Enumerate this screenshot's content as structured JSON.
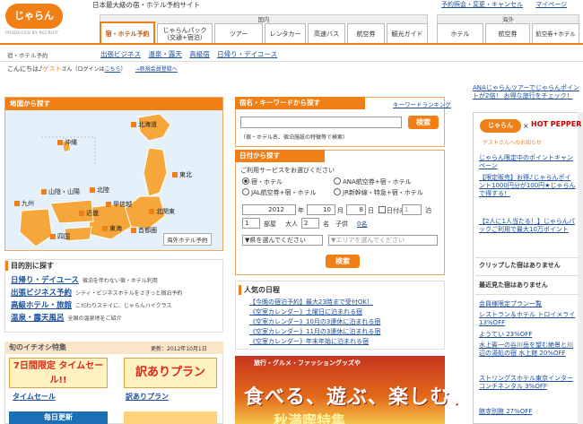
{
  "header": {
    "logo": "じゃらん",
    "logo_sub": "PRODUCED BY RECRUIT",
    "tagline": "日本最大級の宿・ホテル予約サイト",
    "links": [
      "予約照会・変更・キャンセル",
      "マイページ"
    ]
  },
  "tabs": {
    "domestic_label": "国内",
    "overseas_label": "海外",
    "domestic": [
      "宿・ホテル予約",
      "じゃらんパック（交通+宿泊）",
      "ツアー",
      "レンタカー",
      "高速バス",
      "航空券",
      "観光ガイド"
    ],
    "overseas": [
      "ホテル",
      "航空券",
      "航空券+ホテル"
    ]
  },
  "subnav": {
    "label": "宿・ホテル予約",
    "links": [
      "出張ビジネス",
      "温泉・露天",
      "高級宿",
      "日帰り・デイユース"
    ]
  },
  "greeting": {
    "prefix": "こんにちは♪",
    "name": "ゲスト",
    "suffix": "さん（ログインは",
    "login": "こちら",
    "close": "）",
    "register": "→新規会員登録へ"
  },
  "map": {
    "title": "地図から探す",
    "regions": [
      "北海道",
      "東北",
      "北関東",
      "首都圏",
      "甲信越",
      "北陸",
      "東海",
      "近畿",
      "山陰・山陽",
      "四国",
      "九州",
      "沖縄"
    ],
    "overseas": "海外ホテル予約"
  },
  "purpose": {
    "title": "目的別に探す",
    "rows": [
      {
        "link": "日帰り・デイユース",
        "desc": "宿泊を伴わない宿・ホテル利用"
      },
      {
        "link": "出張ビジネス予約",
        "desc": "シティ・ビジネスホテルをさきっと宿泊予約"
      },
      {
        "link": "高級ホテル・旅館",
        "desc": "こだわりステイに、じゃらんハイクラス"
      },
      {
        "link": "温泉・露天風呂",
        "desc": "全国の温泉地をご紹介"
      }
    ]
  },
  "tokushu": {
    "title": "旬のイチオシ特集",
    "updated": "更新：2012年10月1日",
    "banners": [
      {
        "text": "7日間限定 タイムセール!!",
        "caption": "タイムセール"
      },
      {
        "text": "訳ありプラン",
        "caption": "訳ありプラン"
      }
    ],
    "banner3": "毎日更新"
  },
  "keyword": {
    "title": "宿名・キーワードから探す",
    "ranking": "キーワードランキング",
    "button": "検索",
    "note": "（宿・ホテル名、宿泊施設の特徴等で検索）",
    "placeholder": ""
  },
  "date_search": {
    "title": "日付から探す",
    "service_label": "ご利用サービスをお選びください",
    "options": [
      "宿・ホテル",
      "ANA航空券+宿・ホテル",
      "JAL航空券+宿・ホテル",
      "JR新幹線・特急+宿・ホテル"
    ],
    "year": "2012",
    "year_unit": "年",
    "month": "10",
    "month_unit": "月",
    "day": "8",
    "day_unit": "日",
    "undecided": "日付未定",
    "nights": "1",
    "nights_unit": "泊",
    "rooms": "1",
    "rooms_unit": "部屋",
    "adults_label": "大人",
    "adults": "2",
    "adults_unit": "名",
    "children_label": "子供",
    "children": "0名",
    "pref": "▼県を選んでください",
    "area": "▼エリアを選んでください",
    "button": "検索"
  },
  "ninki": {
    "title": "人気の日程",
    "rows": [
      "【今晩の宿泊予約】最大23時まで受付OK！",
      "《空室カレンダー》土曜日に泊まれる宿",
      "《空室カレンダー》10月の3連休に泊まれる宿",
      "《空室カレンダー》11月の3連休に泊まれる宿",
      "《空室カレンダー》年末年始に泊まれる宿"
    ]
  },
  "promo": {
    "line1": "旅行・グルメ・ファッショングッズや",
    "line2": "食べる、遊ぶ、楽しむ、",
    "line3": "秋満喫特集"
  },
  "right": {
    "ana": "ANAじゃらんツアーでじゃらんポイントが2倍！ お得な旅行をチェック！",
    "hp": "HOT PEPPER",
    "guest": "ゲストさんへのお知らせ",
    "campaign_head": "じゃらん限定中のポイントキャンペーン",
    "campaign": [
      "【限定販売】お得♪じゃらんポイント1000円分が100円★じゃらんで得する！",
      "【2人に1人当たる！】じゃらんパックご利用で最大10万ポイント"
    ],
    "clip": "クリップした宿はありません",
    "recent": "最近見た宿はありません",
    "plans_head": "会員様限定プラン一覧",
    "plans": [
      "レストラン＆ホテル トロイメライ 13%OFF",
      "ようてい 23%OFF",
      "水上賓一の谷川岳を望む絶景と川辺の湯処の宿 水上館 20%OFF",
      "ストリングスホテル東京インターコンチネンタル 3%OFF",
      "館寺別館 27%OFF"
    ]
  }
}
